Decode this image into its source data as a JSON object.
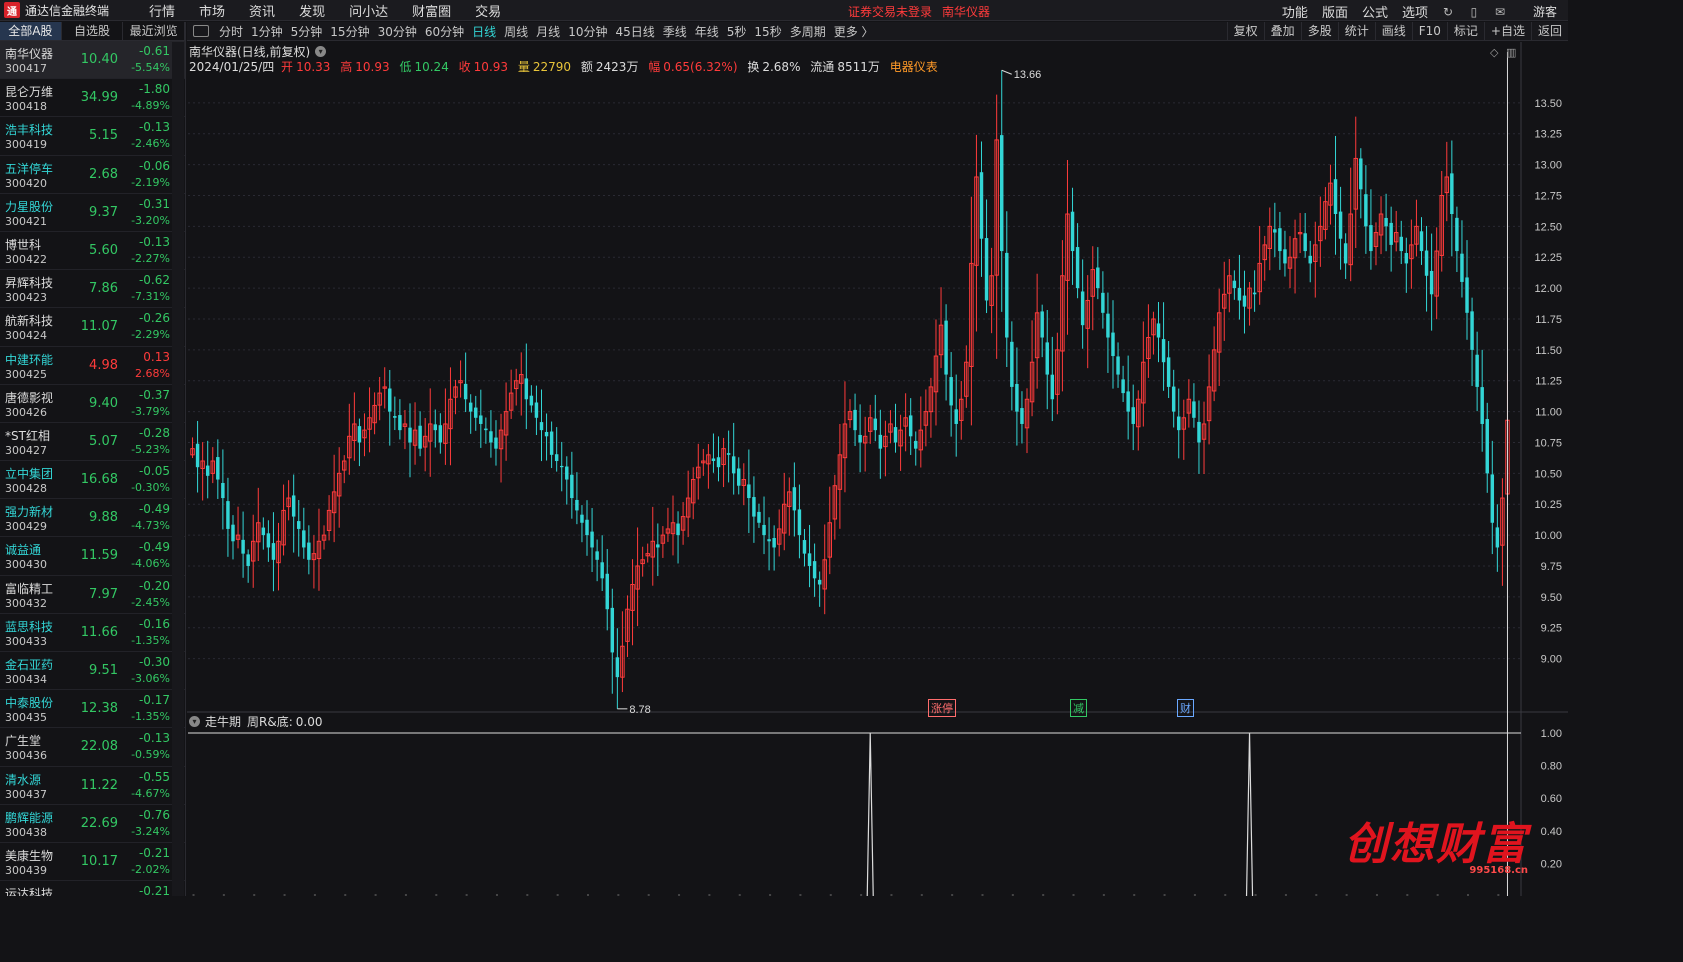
{
  "app": {
    "title": "通达信金融终端",
    "logo_text": "通"
  },
  "menu": [
    "行情",
    "市场",
    "资讯",
    "发现",
    "问小达",
    "财富圈",
    "交易"
  ],
  "login_status": {
    "text": "证券交易未登录",
    "stock": "南华仪器"
  },
  "right_menu": [
    "功能",
    "版面",
    "公式",
    "选项"
  ],
  "right_icons": [
    "↻",
    "▯",
    "✉"
  ],
  "guest_label": "游客",
  "sidebar": {
    "tabs": [
      "全部A股",
      "自选股",
      "最近浏览"
    ],
    "stocks": [
      {
        "name": "南华仪器",
        "code": "300417",
        "price": "10.40",
        "change": "-0.61",
        "pct": "-5.54%",
        "dir": "down",
        "selected": true,
        "cyan": false
      },
      {
        "name": "昆仑万维",
        "code": "300418",
        "price": "34.99",
        "change": "-1.80",
        "pct": "-4.89%",
        "dir": "down",
        "cyan": false
      },
      {
        "name": "浩丰科技",
        "code": "300419",
        "price": "5.15",
        "change": "-0.13",
        "pct": "-2.46%",
        "dir": "down",
        "cyan": true
      },
      {
        "name": "五洋停车",
        "code": "300420",
        "price": "2.68",
        "change": "-0.06",
        "pct": "-2.19%",
        "dir": "down",
        "cyan": true
      },
      {
        "name": "力星股份",
        "code": "300421",
        "price": "9.37",
        "change": "-0.31",
        "pct": "-3.20%",
        "dir": "down",
        "cyan": true
      },
      {
        "name": "博世科",
        "code": "300422",
        "price": "5.60",
        "change": "-0.13",
        "pct": "-2.27%",
        "dir": "down",
        "cyan": false
      },
      {
        "name": "昇辉科技",
        "code": "300423",
        "price": "7.86",
        "change": "-0.62",
        "pct": "-7.31%",
        "dir": "down",
        "cyan": false
      },
      {
        "name": "航新科技",
        "code": "300424",
        "price": "11.07",
        "change": "-0.26",
        "pct": "-2.29%",
        "dir": "down",
        "cyan": false
      },
      {
        "name": "中建环能",
        "code": "300425",
        "price": "4.98",
        "change": "0.13",
        "pct": "2.68%",
        "dir": "up",
        "cyan": true
      },
      {
        "name": "唐德影视",
        "code": "300426",
        "price": "9.40",
        "change": "-0.37",
        "pct": "-3.79%",
        "dir": "down",
        "cyan": false
      },
      {
        "name": "*ST红相",
        "code": "300427",
        "price": "5.07",
        "change": "-0.28",
        "pct": "-5.23%",
        "dir": "down",
        "cyan": false
      },
      {
        "name": "立中集团",
        "code": "300428",
        "price": "16.68",
        "change": "-0.05",
        "pct": "-0.30%",
        "dir": "down",
        "cyan": true
      },
      {
        "name": "强力新材",
        "code": "300429",
        "price": "9.88",
        "change": "-0.49",
        "pct": "-4.73%",
        "dir": "down",
        "cyan": true
      },
      {
        "name": "诚益通",
        "code": "300430",
        "price": "11.59",
        "change": "-0.49",
        "pct": "-4.06%",
        "dir": "down",
        "cyan": true
      },
      {
        "name": "富临精工",
        "code": "300432",
        "price": "7.97",
        "change": "-0.20",
        "pct": "-2.45%",
        "dir": "down",
        "cyan": false
      },
      {
        "name": "蓝思科技",
        "code": "300433",
        "price": "11.66",
        "change": "-0.16",
        "pct": "-1.35%",
        "dir": "down",
        "cyan": true
      },
      {
        "name": "金石亚药",
        "code": "300434",
        "price": "9.51",
        "change": "-0.30",
        "pct": "-3.06%",
        "dir": "down",
        "cyan": true
      },
      {
        "name": "中泰股份",
        "code": "300435",
        "price": "12.38",
        "change": "-0.17",
        "pct": "-1.35%",
        "dir": "down",
        "cyan": true
      },
      {
        "name": "广生堂",
        "code": "300436",
        "price": "22.08",
        "change": "-0.13",
        "pct": "-0.59%",
        "dir": "down",
        "cyan": false
      },
      {
        "name": "清水源",
        "code": "300437",
        "price": "11.22",
        "change": "-0.55",
        "pct": "-4.67%",
        "dir": "down",
        "cyan": true
      },
      {
        "name": "鹏辉能源",
        "code": "300438",
        "price": "22.69",
        "change": "-0.76",
        "pct": "-3.24%",
        "dir": "down",
        "cyan": true
      },
      {
        "name": "美康生物",
        "code": "300439",
        "price": "10.17",
        "change": "-0.21",
        "pct": "-2.02%",
        "dir": "down",
        "cyan": false
      },
      {
        "name": "运达科技",
        "code": "",
        "price": "",
        "change": "-0.21",
        "pct": "",
        "dir": "down",
        "cyan": false
      }
    ]
  },
  "toolbar": {
    "periods": [
      "分时",
      "1分钟",
      "5分钟",
      "15分钟",
      "30分钟",
      "60分钟",
      "日线",
      "周线",
      "月线",
      "10分钟",
      "45日线",
      "季线",
      "年线",
      "5秒",
      "15秒",
      "多周期",
      "更多 〉"
    ],
    "active_period": "日线",
    "right_tools": [
      "复权",
      "叠加",
      "多股",
      "统计",
      "画线",
      "F10",
      "标记",
      "+自选",
      "返回"
    ]
  },
  "chart": {
    "header": "南华仪器(日线,前复权)",
    "ohlc": {
      "date": "2024/01/25/四",
      "open_label": "开",
      "open": "10.33",
      "high_label": "高",
      "high": "10.93",
      "low_label": "低",
      "low": "10.24",
      "close_label": "收",
      "close": "10.93",
      "vol_label": "量",
      "vol": "22790",
      "amount_label": "额",
      "amount": "2423万",
      "amp_label": "幅",
      "amp": "0.65(6.32%)",
      "turnover_label": "换",
      "turnover": "2.68%",
      "float_label": "流通",
      "float": "8511万",
      "sector": "电器仪表"
    },
    "max_label": "13.66",
    "min_label": "8.78",
    "price_ticks": [
      "13.50",
      "13.25",
      "13.00",
      "12.75",
      "12.50",
      "12.25",
      "12.00",
      "11.75",
      "11.50",
      "11.25",
      "11.00",
      "10.75",
      "10.50",
      "10.25",
      "10.00",
      "9.75",
      "9.50",
      "9.25",
      "9.00"
    ],
    "events": [
      {
        "text": "涨停",
        "color": "#ff6d6d"
      },
      {
        "text": "减",
        "color": "#33c864"
      },
      {
        "text": "财",
        "color": "#6aa8ff"
      }
    ],
    "indicator": {
      "name": "走牛期",
      "param_label": "周R&底:",
      "param_value": "0.00",
      "ticks": [
        "1.00",
        "0.80",
        "0.60",
        "0.40",
        "0.20"
      ]
    },
    "colors": {
      "up": "#ff3b3b",
      "down": "#33d6d6",
      "grid": "#2a2a33",
      "bg": "#131316"
    }
  },
  "chart_data": {
    "type": "candlestick",
    "ylim": [
      8.6,
      13.75
    ],
    "closes": [
      10.7,
      10.55,
      10.6,
      10.48,
      10.6,
      10.45,
      10.3,
      10.05,
      9.95,
      10.0,
      9.85,
      9.75,
      9.95,
      10.1,
      10.0,
      9.9,
      9.8,
      9.95,
      10.2,
      10.3,
      10.15,
      10.05,
      9.9,
      9.8,
      9.85,
      9.95,
      10.0,
      10.2,
      10.35,
      10.5,
      10.6,
      10.8,
      10.9,
      10.75,
      10.85,
      10.95,
      11.05,
      11.15,
      11.2,
      11.0,
      10.95,
      10.85,
      10.9,
      10.75,
      10.85,
      10.7,
      10.8,
      10.9,
      10.85,
      10.75,
      10.9,
      11.1,
      11.2,
      11.25,
      11.1,
      11.0,
      10.95,
      10.9,
      10.85,
      10.75,
      10.7,
      10.85,
      11.0,
      11.15,
      11.25,
      11.3,
      11.1,
      11.05,
      10.95,
      10.85,
      10.8,
      10.65,
      10.6,
      10.55,
      10.45,
      10.3,
      10.2,
      10.1,
      10.0,
      9.9,
      9.8,
      9.65,
      9.4,
      9.05,
      8.85,
      9.1,
      9.4,
      9.6,
      9.75,
      9.8,
      9.85,
      9.95,
      9.9,
      10.0,
      10.05,
      10.1,
      10.0,
      10.15,
      10.3,
      10.45,
      10.55,
      10.6,
      10.65,
      10.6,
      10.55,
      10.7,
      10.65,
      10.5,
      10.4,
      10.45,
      10.3,
      10.15,
      10.1,
      10.0,
      9.95,
      9.9,
      10.05,
      10.25,
      10.35,
      10.2,
      10.0,
      9.85,
      9.75,
      9.65,
      9.6,
      9.8,
      10.1,
      10.4,
      10.65,
      10.9,
      11.0,
      10.85,
      10.75,
      10.8,
      10.95,
      10.85,
      10.7,
      10.8,
      10.9,
      10.75,
      10.85,
      10.95,
      10.8,
      10.7,
      10.85,
      11.0,
      11.2,
      11.45,
      11.7,
      11.3,
      11.05,
      10.9,
      11.1,
      11.4,
      12.2,
      12.9,
      12.4,
      11.9,
      12.1,
      13.2,
      12.3,
      11.6,
      11.2,
      11.0,
      10.9,
      11.1,
      11.4,
      11.8,
      11.6,
      11.3,
      11.1,
      11.5,
      12.1,
      12.6,
      12.3,
      12.0,
      11.7,
      11.9,
      12.15,
      12.0,
      11.8,
      11.6,
      11.45,
      11.3,
      11.15,
      11.0,
      10.9,
      11.1,
      11.4,
      11.6,
      11.75,
      11.6,
      11.4,
      11.2,
      11.0,
      10.85,
      10.95,
      11.1,
      10.95,
      10.75,
      10.9,
      11.2,
      11.5,
      11.8,
      11.95,
      12.1,
      12.0,
      11.9,
      11.85,
      12.0,
      11.95,
      12.2,
      12.35,
      12.5,
      12.45,
      12.3,
      12.2,
      12.25,
      12.4,
      12.45,
      12.3,
      12.2,
      12.35,
      12.5,
      12.7,
      12.85,
      12.6,
      12.4,
      12.2,
      12.6,
      13.05,
      12.8,
      12.5,
      12.3,
      12.45,
      12.6,
      12.5,
      12.35,
      12.45,
      12.3,
      12.2,
      12.35,
      12.5,
      12.3,
      12.1,
      11.95,
      12.3,
      12.75,
      12.9,
      12.6,
      12.3,
      12.05,
      11.8,
      11.5,
      11.2,
      10.9,
      10.5,
      10.1,
      9.9,
      10.3,
      10.93
    ],
    "indicator_peaks": [
      {
        "index": 134,
        "value": 1.0
      },
      {
        "index": 209,
        "value": 1.0
      }
    ]
  }
}
